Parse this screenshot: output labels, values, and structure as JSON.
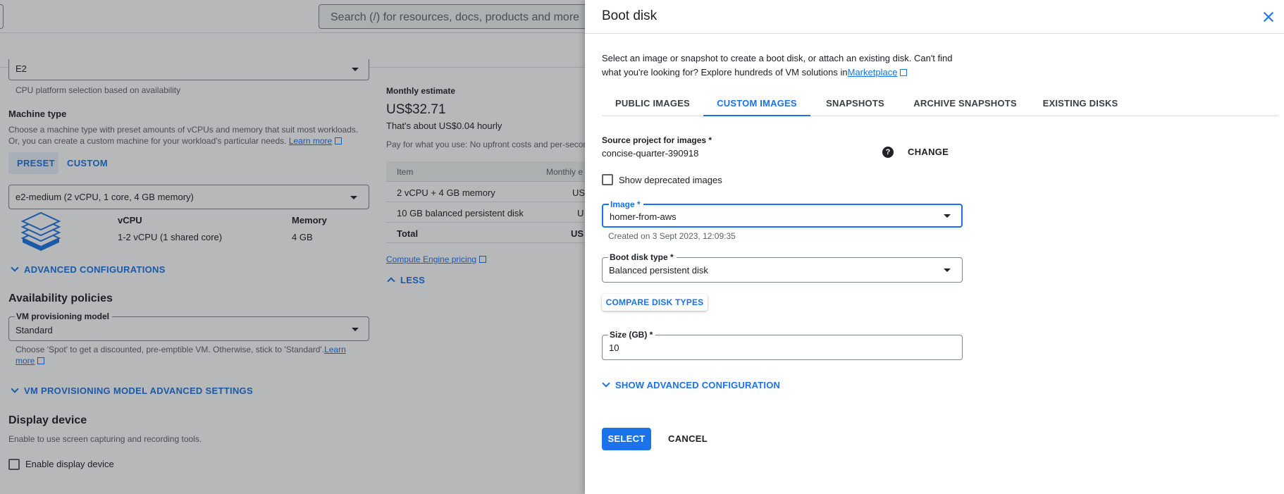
{
  "background": {
    "search_placeholder": "Search (/) for resources, docs, products and more",
    "series_value": "E2",
    "cpu_platform_hint": "CPU platform selection based on availability",
    "machine_type": {
      "heading": "Machine type",
      "desc_line1": "Choose a machine type with preset amounts of vCPUs and memory that suit most workloads.",
      "desc_line2": "Or, you can create a custom machine for your workload's particular needs.",
      "learn_more": "Learn more",
      "preset_label": "PRESET",
      "custom_label": "CUSTOM",
      "selected": "e2-medium (2 vCPU, 1 core, 4 GB memory)",
      "vcpu_header": "vCPU",
      "vcpu_value": "1-2 vCPU (1 shared core)",
      "memory_header": "Memory",
      "memory_value": "4 GB",
      "advanced_configs": "ADVANCED CONFIGURATIONS"
    },
    "availability": {
      "heading": "Availability policies",
      "model_label": "VM provisioning model",
      "model_value": "Standard",
      "hint": "Choose 'Spot' to get a discounted, pre-emptible VM. Otherwise, stick to 'Standard'.",
      "learn": "Learn",
      "more": "more",
      "advanced_settings": "VM PROVISIONING MODEL ADVANCED SETTINGS"
    },
    "display": {
      "heading": "Display device",
      "hint": "Enable to use screen capturing and recording tools.",
      "checkbox_label": "Enable display device"
    },
    "estimate": {
      "label": "Monthly estimate",
      "amount": "US$32.71",
      "hourly": "That's about US$0.04 hourly",
      "pay_note": "Pay for what you use: No upfront costs and per-secon",
      "col_item": "Item",
      "col_monthly": "Monthly e",
      "rows": [
        {
          "item": "2 vCPU + 4 GB memory",
          "cost": "US"
        },
        {
          "item": "10 GB balanced persistent disk",
          "cost": "U"
        },
        {
          "item": "Total",
          "cost": "US"
        }
      ],
      "pricing_link": "Compute Engine pricing",
      "less": "LESS"
    }
  },
  "panel": {
    "title": "Boot disk",
    "desc_line1": "Select an image or snapshot to create a boot disk, or attach an existing disk. Can't find",
    "desc_line2": "what you're looking for? Explore hundreds of VM solutions in",
    "marketplace_link": "Marketplace",
    "tabs": [
      "PUBLIC IMAGES",
      "CUSTOM IMAGES",
      "SNAPSHOTS",
      "ARCHIVE SNAPSHOTS",
      "EXISTING DISKS"
    ],
    "active_tab": "CUSTOM IMAGES",
    "source_project_label": "Source project for images *",
    "source_project_value": "concise-quarter-390918",
    "change_label": "CHANGE",
    "deprecated_label": "Show deprecated images",
    "image_label": "Image *",
    "image_value": "homer-from-aws",
    "image_hint": "Created on 3 Sept 2023, 12:09:35",
    "disk_type_label": "Boot disk type *",
    "disk_type_value": "Balanced persistent disk",
    "compare_label": "COMPARE DISK TYPES",
    "size_label": "Size (GB) *",
    "size_value": "10",
    "advanced_label": "SHOW ADVANCED CONFIGURATION",
    "select_label": "SELECT",
    "cancel_label": "CANCEL"
  },
  "colors": {
    "accent": "#1a73e8",
    "scrim": "rgba(32,33,36,0.32)"
  },
  "icons": {
    "close": "close-icon",
    "help": "help-icon",
    "external": "external-link-icon",
    "chevron": "chevron-down-icon",
    "dropdown": "dropdown-arrow-icon"
  }
}
